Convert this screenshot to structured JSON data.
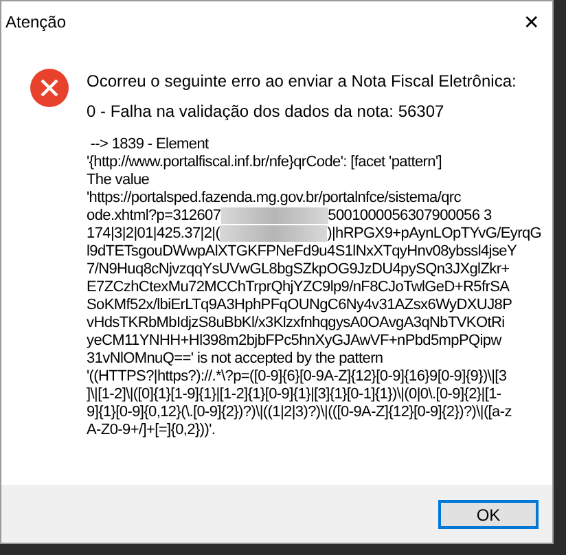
{
  "window": {
    "title": "Atenção",
    "close": "✕"
  },
  "message": {
    "heading": "Ocorreu o seguinte erro ao enviar a Nota Fiscal Eletrônica:",
    "summary": "0 - Falha na validação dos dados da nota: 56307",
    "detail_lines": [
      [
        {
          "kind": "text",
          "text": " --> 1839 - Element"
        }
      ],
      [
        {
          "kind": "text",
          "text": "'{http://www.portalfiscal.inf.br/nfe}qrCode': [facet 'pattern']"
        }
      ],
      [
        {
          "kind": "text",
          "text": "The value"
        }
      ],
      [
        {
          "kind": "text",
          "text": "'https://portalsped.fazenda.mg.gov.br/portalnfce/sistema/qrc"
        }
      ],
      [
        {
          "kind": "text",
          "text": "ode.xhtml?p=312607"
        },
        {
          "kind": "redacted"
        },
        {
          "kind": "text",
          "text": "5001000056307900056 3"
        }
      ],
      [
        {
          "kind": "text",
          "text": "174|3|2|01|425.37|2|("
        },
        {
          "kind": "redacted"
        },
        {
          "kind": "text",
          "text": ")|hRPGX9+pAynLOpTYvG/EyrqG"
        }
      ],
      [
        {
          "kind": "text",
          "text": "l9dTETsgouDWwpAlXTGKFPNeFd9u4S1lNxXTqyHnv08ybssl4jseY"
        }
      ],
      [
        {
          "kind": "text",
          "text": "7/N9Huq8cNjvzqqYsUVwGL8bgSZkpOG9JzDU4pySQn3JXglZkr+"
        }
      ],
      [
        {
          "kind": "text",
          "text": "E7ZCzhCtexMu72MCChTrprQhjYZC9lp9/nF8CJoTwlGeD+R5frSA"
        }
      ],
      [
        {
          "kind": "text",
          "text": "SoKMf52x/lbiErLTq9A3HphPFqOUNgC6Ny4v31AZsx6WyDXUJ8P"
        }
      ],
      [
        {
          "kind": "text",
          "text": "vHdsTKRbMbIdjzS8uBbKl/x3KlzxfnhqgysA0OAvgA3qNbTVKOtRi"
        }
      ],
      [
        {
          "kind": "text",
          "text": "yeCM11YNHH+Hl398m2bjbFPc5hnXyGJAwVF+nPbd5mpPQipw"
        }
      ],
      [
        {
          "kind": "text",
          "text": "31vNlOMnuQ==' is not accepted by the pattern"
        }
      ],
      [
        {
          "kind": "text",
          "text": "'((HTTPS?|https?)://.*\\?p=([0-9]{6}[0-9A-Z]{12}[0-9]{16}9[0-9]{9})\\|[3"
        }
      ],
      [
        {
          "kind": "text",
          "text": "]\\|[1-2]\\|([0]{1}[1-9]{1}|[1-2]{1}[0-9]{1}|[3]{1}[0-1]{1})\\|(0|0\\.[0-9]{2}|[1-"
        }
      ],
      [
        {
          "kind": "text",
          "text": "9]{1}[0-9]{0,12}(\\.[0-9]{2})?)\\|((1|2|3)?)\\|(([0-9A-Z]{12}[0-9]{2})?)\\|([a-z"
        }
      ],
      [
        {
          "kind": "text",
          "text": "A-Z0-9+/]+[=]{0,2}))'."
        }
      ]
    ]
  },
  "buttons": [
    {
      "label": "OK",
      "selected": true
    }
  ]
}
